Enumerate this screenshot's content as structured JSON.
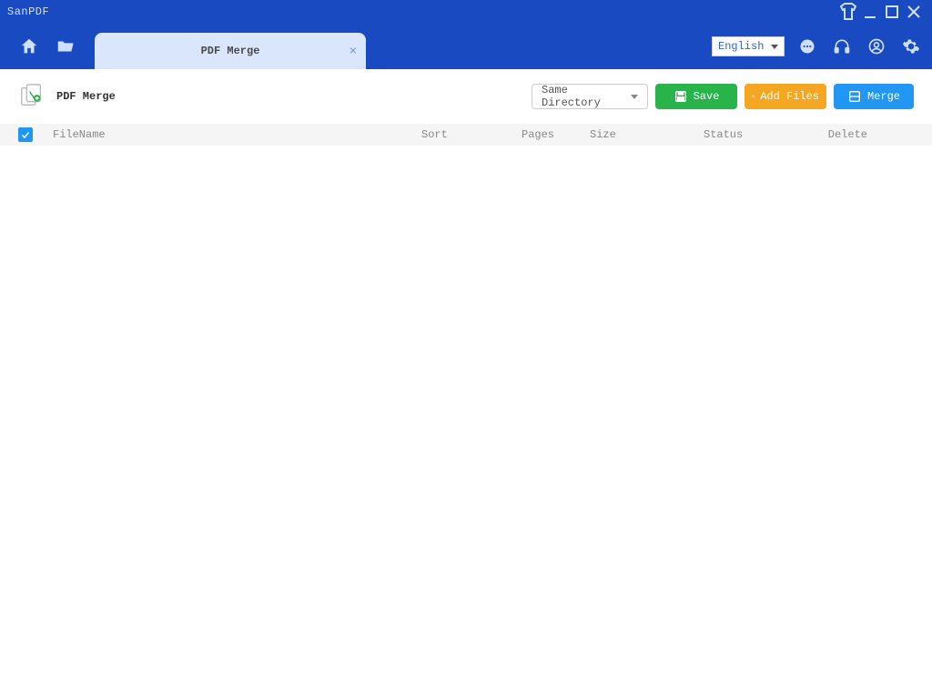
{
  "window": {
    "title": "SanPDF"
  },
  "header": {
    "tab_label": "PDF Merge",
    "language": "English"
  },
  "toolbar": {
    "page_title": "PDF Merge",
    "directory_mode": "Same Directory",
    "save_label": "Save",
    "add_files_label": "Add Files",
    "merge_label": "Merge"
  },
  "table": {
    "columns": {
      "filename": "FileName",
      "sort": "Sort",
      "pages": "Pages",
      "size": "Size",
      "status": "Status",
      "delete": "Delete"
    },
    "rows": []
  },
  "colors": {
    "brand_blue": "#1a4ac2",
    "btn_green": "#28b44b",
    "btn_orange": "#f5a623",
    "btn_blue": "#2196f3"
  }
}
